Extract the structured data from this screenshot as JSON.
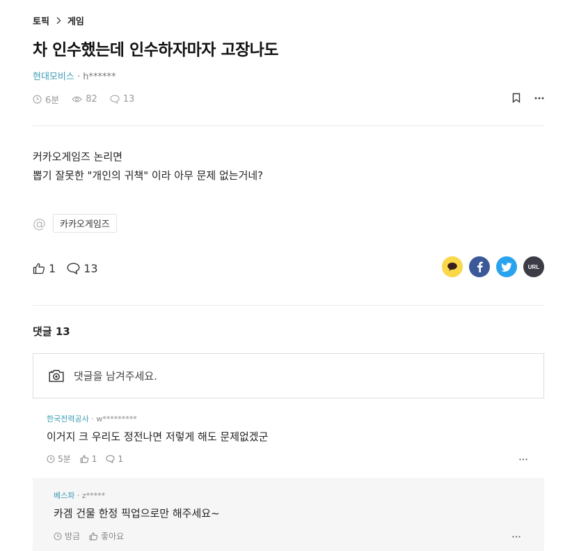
{
  "breadcrumb": {
    "root": "토픽",
    "current": "게임"
  },
  "post": {
    "title": "차 인수했는데 인수하자마자 고장나도",
    "company": "현대모비스",
    "author_sep": " · ",
    "author": "h******",
    "time": "6분",
    "views": "82",
    "comments": "13",
    "body_line1": "커카오게임즈 논리면",
    "body_line2": "뽑기 잘못한 \"개인의 귀책\" 이라 아무 문제 없는거네?",
    "tag": "카카오게임즈",
    "likes": "1",
    "comment_count": "13"
  },
  "share": {
    "url_label": "URL"
  },
  "comments_section": {
    "header": "댓글 13",
    "input_placeholder": "댓글을 남겨주세요."
  },
  "comments": [
    {
      "company": "한국전력공사",
      "sep": " · ",
      "author": "w*********",
      "text": "이거지 크 우리도 정전나면 저렇게 해도 문제없겠군",
      "time": "5분",
      "likes": "1",
      "replies": "1"
    },
    {
      "company": "베스파",
      "sep": " · ",
      "author": "z*****",
      "text": "카겜 건물 한정 픽업으로만 해주세요~",
      "time": "방금",
      "like_label": "좋아요"
    }
  ],
  "colors": {
    "accent": "#3a9bb5",
    "kakao": "#f9d84a",
    "facebook": "#3b5998",
    "twitter": "#2aa3ef",
    "url": "#3c3c46"
  }
}
